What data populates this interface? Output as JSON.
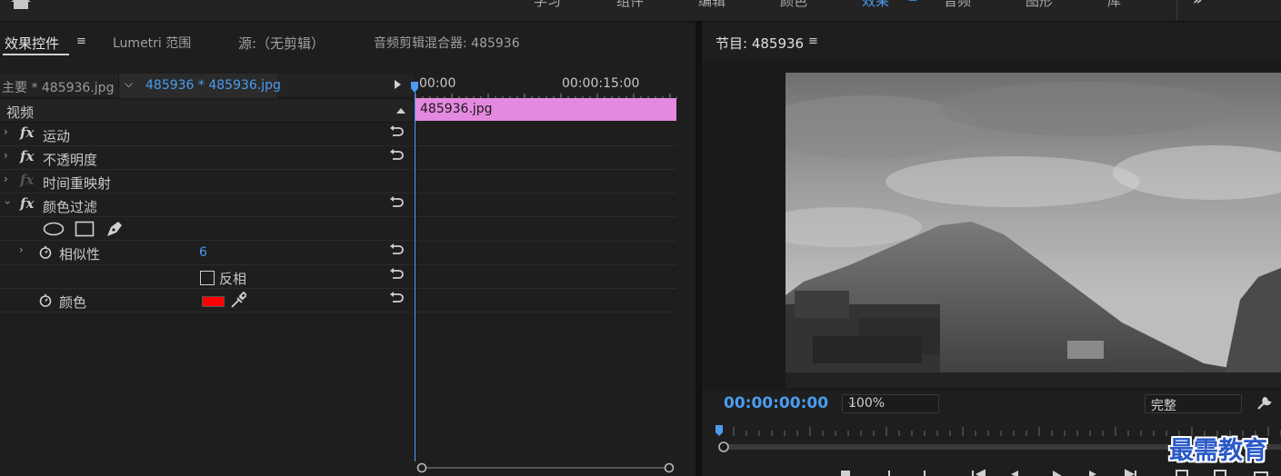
{
  "workspaces": {
    "items": [
      "学习",
      "组件",
      "编辑",
      "颜色",
      "效果",
      "音频",
      "图形",
      "库"
    ],
    "active": "效果"
  },
  "panel_tabs": {
    "effect_controls": "效果控件",
    "lumetri_scopes": "Lumetri 范围",
    "source": "源:（无剪辑）",
    "audio_mixer": "音频剪辑混合器: 485936"
  },
  "effect_controls": {
    "master_clip": "主要 * 485936.jpg",
    "selected_clip": "485936 * 485936.jpg",
    "section_video": "视频",
    "effects": [
      {
        "label": "运动",
        "enabled": true
      },
      {
        "label": "不透明度",
        "enabled": true
      },
      {
        "label": "时间重映射",
        "enabled": false
      },
      {
        "label": "颜色过滤",
        "enabled": true
      }
    ],
    "params": {
      "similarity_label": "相似性",
      "similarity_value": "6",
      "invert_label": "反相",
      "color_label": "颜色",
      "color_value": "#ff0000"
    }
  },
  "mini_timeline": {
    "time_start": "00:00",
    "time_mid": "00:00:15:00",
    "clip_name": "485936.jpg",
    "clip_color": "#e489e0"
  },
  "program_monitor": {
    "title": "节目: 485936",
    "timecode": "00:00:00:00",
    "zoom": "100%",
    "quality": "完整"
  },
  "watermark": "最需教育",
  "colors": {
    "accent": "#4b9cf0",
    "panel_bg": "#1e1e1e"
  }
}
